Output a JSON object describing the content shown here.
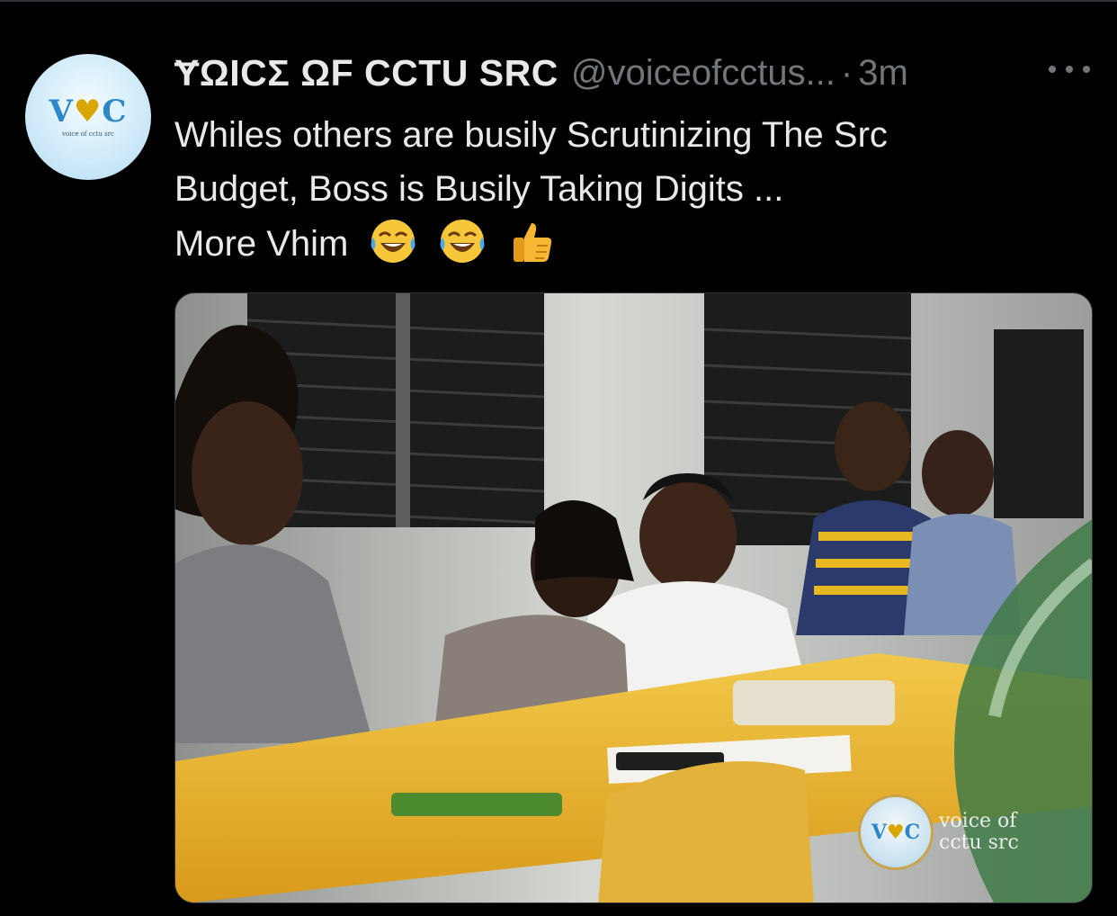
{
  "tweet": {
    "display_name": "ɎΩICΣ ΩF CCTU SRC",
    "handle": "@voiceofcctus...",
    "separator": "·",
    "time": "3m",
    "text_lines": [
      "Whiles others are busily Scrutinizing The Src",
      "Budget, Boss is Busily Taking Digits ...",
      "More Vhim"
    ],
    "emojis": [
      "face-with-tears-of-joy-icon",
      "face-with-tears-of-joy-icon",
      "thumbs-up-icon"
    ]
  },
  "avatar": {
    "logo_left": "V",
    "logo_mid": "♥",
    "logo_right": "C",
    "caption": "voice of cctu src"
  },
  "media": {
    "watermark_logo_left": "V",
    "watermark_logo_mid": "♥",
    "watermark_logo_right": "C",
    "watermark_text_line1": "voice of",
    "watermark_text_line2": "cctu src"
  },
  "colors": {
    "background": "#000000",
    "text": "#e7e9ea",
    "secondary": "#71767b",
    "brand_blue": "#2d86c8",
    "brand_gold": "#d9a500"
  }
}
